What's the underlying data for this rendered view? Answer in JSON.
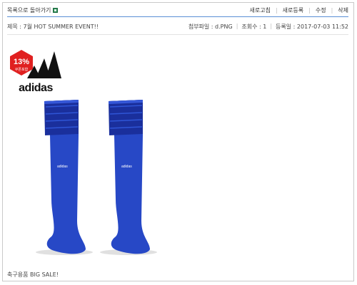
{
  "nav": {
    "back_label": "목록으로 돌아가기",
    "actions": [
      "새로고침",
      "새로등록",
      "수정",
      "삭제"
    ]
  },
  "post": {
    "title": "제목 : 7월 HOT SUMMER EVENT!!",
    "attachment": "첨부파일 : d.PNG",
    "views": "조회수 : 1",
    "date": "등록일 : 2017-07-03 11:52"
  },
  "image": {
    "badge_percent": "13%",
    "badge_sub": "쿠폰포함",
    "brand": "adidas",
    "sock_brand": "adidas",
    "colors": {
      "sock": "#2748c6",
      "sock_dark": "#1a2f9c",
      "badge": "#e02020"
    }
  },
  "body_text": "축구용품 BIG SALE!"
}
